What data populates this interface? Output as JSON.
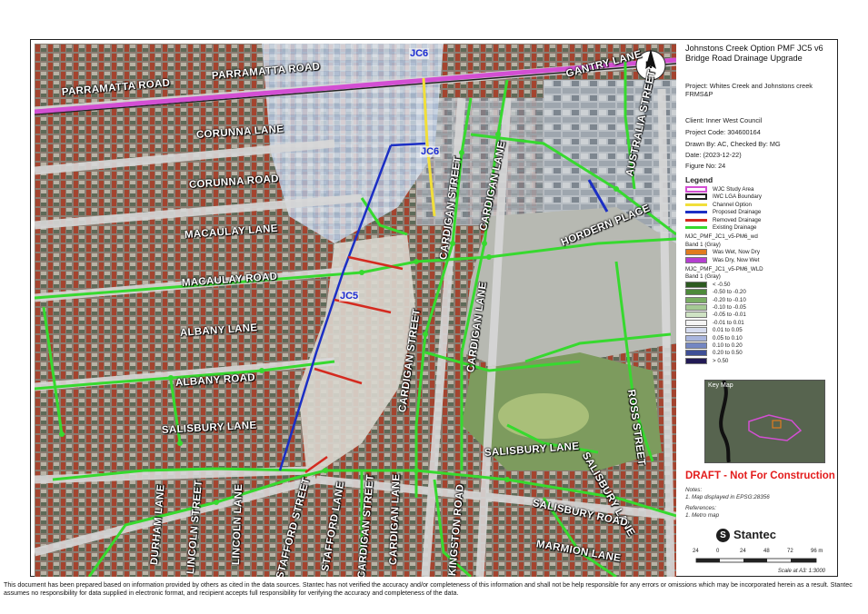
{
  "title": "Johnstons Creek Option PMF JC5 v6 Bridge Road Drainage Upgrade",
  "project_label": "Project:",
  "project_value": "Whites Creek and Johnstons creek FRMS&P",
  "client": "Client:  Inner West Council",
  "project_code": "Project Code:  304600164",
  "drawn_by": "Drawn By:  AC, Checked By: MG",
  "date": "Date:  (2023-12-22)",
  "figure_no": "Figure No:  24",
  "legend": {
    "heading": "Legend",
    "items": [
      {
        "label": "WJC Study Area",
        "color": "#d34fd3",
        "kind": "outline"
      },
      {
        "label": "IWC LGA Boundary",
        "color": "#222222",
        "kind": "outline"
      },
      {
        "label": "Channel Option",
        "color": "#f1df3a",
        "kind": "line"
      },
      {
        "label": "Proposed Drainage",
        "color": "#1c2fc4",
        "kind": "line"
      },
      {
        "label": "Removed Drainage",
        "color": "#d42a1f",
        "kind": "line"
      },
      {
        "label": "Existing Drainage",
        "color": "#37d92f",
        "kind": "line"
      }
    ],
    "group1_title": "MJC_PMF_JC1_v5-PM6_wd",
    "group1_band": "Band 1 (Gray)",
    "group1_items": [
      {
        "label": "Was Wet, Now Dry",
        "color": "#e07b1f"
      },
      {
        "label": "Was Dry, Now Wet",
        "color": "#b43fd0"
      }
    ],
    "group2_title": "MJC_PMF_JC1_v5-PM6_WLD",
    "group2_band": "Band 1 (Gray)",
    "group2_items": [
      {
        "label": "< -0.50",
        "color": "#2c5a20"
      },
      {
        "label": "-0.50 to -0.20",
        "color": "#4d8a3a"
      },
      {
        "label": "-0.20 to -0.10",
        "color": "#79ad63"
      },
      {
        "label": "-0.10 to -0.05",
        "color": "#a5c994"
      },
      {
        "label": "-0.05 to -0.01",
        "color": "#cfe3c4"
      },
      {
        "label": "-0.01 to 0.01",
        "color": "#f4f4f4"
      },
      {
        "label": "0.01 to 0.05",
        "color": "#d6dcef"
      },
      {
        "label": "0.05 to 0.10",
        "color": "#a9b6de"
      },
      {
        "label": "0.10 to 0.20",
        "color": "#7386c2"
      },
      {
        "label": "0.20 to 0.50",
        "color": "#3e4f96"
      },
      {
        "label": "> 0.50",
        "color": "#221a55"
      }
    ]
  },
  "keymap_title": "Key Map",
  "draft": "DRAFT - Not For Construction",
  "notes_heading": "Notes:",
  "notes_1": "1. Map displayed in EPSG:28356",
  "references_heading": "References:",
  "references_1": "1. Metro map",
  "logo_text": "Stantec",
  "scale": {
    "ticks": [
      "24",
      "0",
      "24",
      "48",
      "72",
      "96 m"
    ],
    "caption": "Scale at A3: 1:3000"
  },
  "north": "N",
  "labels": {
    "jc6_top": "JC6",
    "jc6_mid": "JC6",
    "jc5": "JC5"
  },
  "streets": [
    {
      "name": "PARRAMATTA ROAD"
    },
    {
      "name": "PARRAMATTA ROAD"
    },
    {
      "name": "GANTRY LANE"
    },
    {
      "name": "AUSTRALIA STREET"
    },
    {
      "name": "CORUNNA LANE"
    },
    {
      "name": "CORUNNA ROAD"
    },
    {
      "name": "MACAULAY LANE"
    },
    {
      "name": "MACAULAY ROAD"
    },
    {
      "name": "ALBANY LANE"
    },
    {
      "name": "ALBANY ROAD"
    },
    {
      "name": "SALISBURY LANE"
    },
    {
      "name": "CARDIGAN STREET"
    },
    {
      "name": "CARDIGAN LANE"
    },
    {
      "name": "CARDIGAN LANE"
    },
    {
      "name": "CARDIGAN STREET"
    },
    {
      "name": "HORDERN PLACE"
    },
    {
      "name": "ROSS STREET"
    },
    {
      "name": "SALISBURY LANE"
    },
    {
      "name": "SALISBURY LANE"
    },
    {
      "name": "SALISBURY ROAD"
    },
    {
      "name": "DURHAM LANE"
    },
    {
      "name": "LINCOLN STREET"
    },
    {
      "name": "LINCOLN LANE"
    },
    {
      "name": "STAFFORD STREET"
    },
    {
      "name": "STAFFORD LANE"
    },
    {
      "name": "CARDIGAN STREET"
    },
    {
      "name": "CARDIGAN LANE"
    },
    {
      "name": "KINGSTON ROAD"
    },
    {
      "name": "MARMION LANE"
    }
  ],
  "disclaimer": "This document has been prepared based on information provided by others as cited in the data sources. Stantec has not verified the accuracy and/or completeness of this information and shall not be help responsible for any errors or omissions which may be incorporated herein as a result. Stantec assumes no responsibility for data supplied in electronic format, and recipient accepts full responsibility for verifying the accuracy and completeness of the data."
}
